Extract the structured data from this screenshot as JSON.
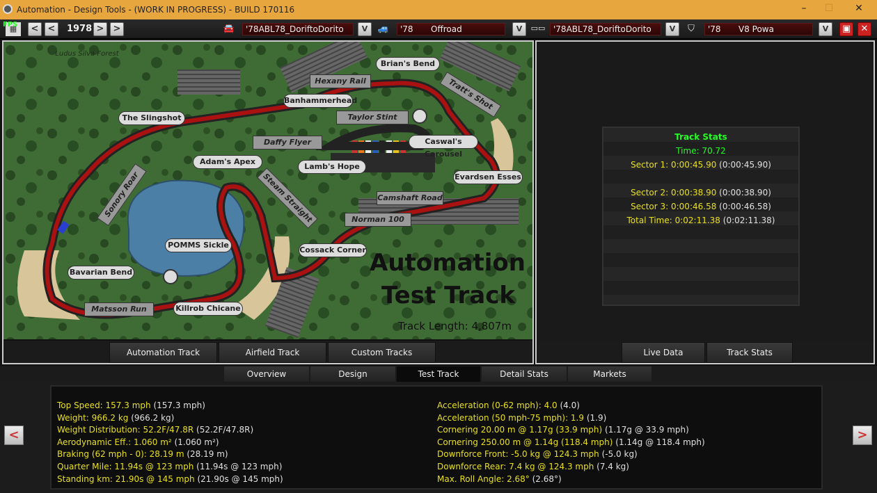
{
  "window": {
    "title": "Automation - Design Tools - (WORK IN PROGRESS) - BUILD 170116",
    "minimize": "–",
    "maximize": "☐",
    "close": "✕"
  },
  "fps": "FPS",
  "toolbar": {
    "year": "1978",
    "model_family": "'78ABL78_DoriftoDorito",
    "trim_year": "'78",
    "trim_name": "Offroad",
    "body": "'78ABL78_DoriftoDorito",
    "engine_year": "'78",
    "engine_name": "V8 Powa",
    "dropdown_label": "V",
    "prev": "<",
    "next": ">"
  },
  "track_map": {
    "labels": [
      "Ludus Silva Forest",
      "Brian's Bend",
      "Hexany Rail",
      "Tratt's Shot",
      "Banhammerhead",
      "Taylor Stint",
      "The Slingshot",
      "Caswal's Carousel",
      "Daffy Flyer",
      "Adam's Apex",
      "Lamb's Hope",
      "Evardsen Esses",
      "Sonory Roar",
      "Steam Straight",
      "Camshaft Road",
      "Norman 100",
      "POMMS Sickle",
      "Cossack Corner",
      "Bavarian Bend",
      "Matsson Run",
      "Killrob Chicane"
    ],
    "big_title_1": "Automation",
    "big_title_2": "Test Track",
    "length": "Track Length: 4,807m"
  },
  "track_tabs": [
    "Automation Track",
    "Airfield Track",
    "Custom Tracks"
  ],
  "right_tabs": [
    "Live Data",
    "Track Stats"
  ],
  "track_stats": {
    "header": "Track Stats",
    "time": "Time: 70.72",
    "sector1": "Sector 1: 0:00:45.90",
    "sector1_paren": "(0:00:45.90)",
    "sector2": "Sector 2: 0:00:38.90",
    "sector2_paren": "(0:00:38.90)",
    "sector3": "Sector 3: 0:00:46.58",
    "sector3_paren": "(0:00:46.58)",
    "total": "Total Time: 0:02:11.38",
    "total_paren": "(0:02:11.38)"
  },
  "nav_tabs": [
    "Overview",
    "Design",
    "Test Track",
    "Detail Stats",
    "Markets"
  ],
  "nav_active": "Test Track",
  "stats_left": [
    {
      "label": "Top Speed: 157.3 mph",
      "paren": "(157.3 mph)"
    },
    {
      "label": "Weight: 966.2 kg",
      "paren": "(966.2 kg)"
    },
    {
      "label": "Weight Distribution: 52.2F/47.8R",
      "paren": "(52.2F/47.8R)"
    },
    {
      "label": "Aerodynamic Eff.: 1.060 m²",
      "paren": "(1.060 m²)"
    },
    {
      "label": "Braking (62 mph - 0): 28.19 m",
      "paren": "(28.19 m)"
    },
    {
      "label": "Quarter Mile: 11.94s @ 123 mph",
      "paren": "(11.94s @ 123 mph)"
    },
    {
      "label": "Standing km: 21.90s @ 145 mph",
      "paren": "(21.90s @ 145 mph)"
    }
  ],
  "stats_right": [
    {
      "label": "Acceleration (0-62 mph): 4.0",
      "paren": "(4.0)"
    },
    {
      "label": "Acceleration (50 mph-75 mph): 1.9",
      "paren": "(1.9)"
    },
    {
      "label": "Cornering 20.00 m @ 1.17g (33.9 mph)",
      "paren": "(1.17g @ 33.9 mph)"
    },
    {
      "label": "Cornering 250.00 m @ 1.14g (118.4 mph)",
      "paren": "(1.14g @ 118.4 mph)"
    },
    {
      "label": "Downforce Front: -5.0 kg @ 124.3 mph",
      "paren": "(-5.0 kg)"
    },
    {
      "label": "Downforce Rear: 7.4 kg @ 124.3 mph",
      "paren": "(7.4 kg)"
    },
    {
      "label": "Max. Roll Angle: 2.68°",
      "paren": "(2.68°)"
    }
  ],
  "page_prev": "<",
  "page_next": ">",
  "colors": {
    "accent": "#e8a73e",
    "stat_yellow": "#e8e020",
    "stat_green": "#22ff22",
    "grass": "#3d6b32",
    "track_red": "#a11"
  }
}
